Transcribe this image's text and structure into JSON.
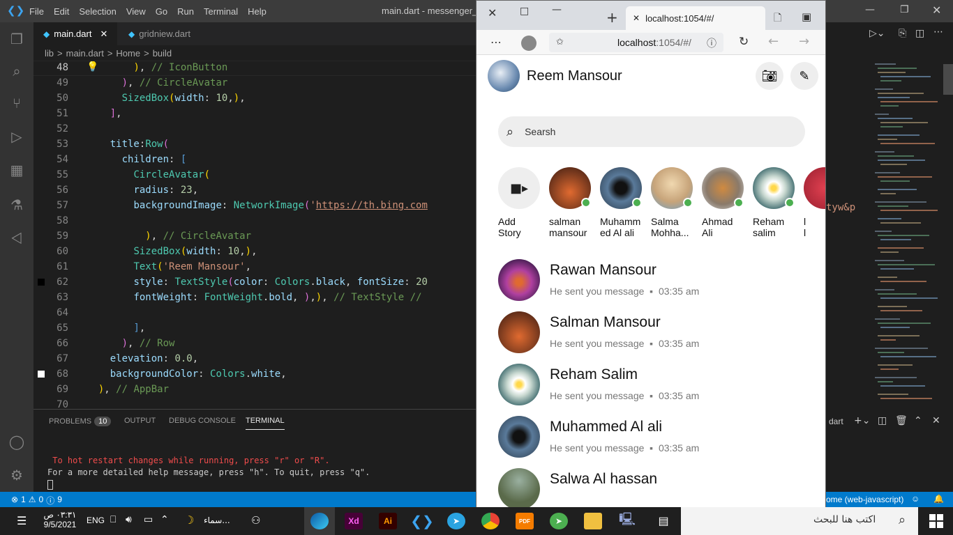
{
  "window": {
    "menu": [
      "File",
      "Edit",
      "Selection",
      "View",
      "Go",
      "Run",
      "Terminal",
      "Help"
    ],
    "title": "main.dart - messenger_pr"
  },
  "editor": {
    "tabs": [
      {
        "label": "main.dart",
        "active": true
      },
      {
        "label": "gridniew.dart",
        "active": false
      }
    ],
    "breadcrumb": [
      "lib",
      ">",
      "main.dart",
      ">",
      "Home",
      ">",
      "build"
    ],
    "line_numbers": [
      "48",
      "49",
      "50",
      "51",
      "52",
      "53",
      "54",
      "55",
      "56",
      "57",
      "58",
      "59",
      "60",
      "61",
      "62",
      "63",
      "64",
      "65",
      "66",
      "67",
      "68",
      "69",
      "70"
    ],
    "current_line": "48"
  },
  "panel": {
    "tabs": [
      "PROBLEMS",
      "OUTPUT",
      "DEBUG CONSOLE",
      "TERMINAL"
    ],
    "problems_count": "10",
    "active_tab": "TERMINAL",
    "right_label": "dart",
    "terminal_lines": [
      " To hot restart changes while running, press \"r\" or \"R\".",
      "For a more detailed help message, press \"h\". To quit, press \"q\"."
    ],
    "prompt": ""
  },
  "statusbar": {
    "errors": "1",
    "warnings": "0",
    "info": "9",
    "right_text": "ome (web-javascript)"
  },
  "browser": {
    "tab_title": "localhost:1054/#/",
    "url_host": "localhost",
    "url_path": ":1054/#/"
  },
  "app": {
    "profile_name": "Reem Mansour",
    "search_placeholder": "Searsh",
    "stories": [
      {
        "name_line1": "Add",
        "name_line2": "Story",
        "type": "add",
        "online": false
      },
      {
        "name_line1": "salman",
        "name_line2": "mansour",
        "online": true,
        "color": "#7a3a1e"
      },
      {
        "name_line1": "Muhamm",
        "name_line2": "ed Al ali",
        "online": true,
        "color": "#2a3a4a"
      },
      {
        "name_line1": "Salma",
        "name_line2": "Mohha...",
        "online": true,
        "color": "#c7a47a"
      },
      {
        "name_line1": "Ahmad",
        "name_line2": "Ali",
        "online": true,
        "color": "#8a7a6a"
      },
      {
        "name_line1": "Reham",
        "name_line2": "salim",
        "online": true,
        "color": "#3f6b6e"
      },
      {
        "name_line1": "l",
        "name_line2": "l",
        "online": false,
        "color": "#9a2030"
      }
    ],
    "chats": [
      {
        "name": "Rawan Mansour",
        "message": "He sent you message",
        "time": "03:35 am",
        "color": "#5a2a6a"
      },
      {
        "name": "Salman Mansour",
        "message": "He sent you message",
        "time": "03:35 am",
        "color": "#7a3a1e"
      },
      {
        "name": "Reham Salim",
        "message": "He sent you message",
        "time": "03:35 am",
        "color": "#3f6b6e"
      },
      {
        "name": "Muhammed Al ali",
        "message": "He sent you message",
        "time": "03:35 am",
        "color": "#2a3a4a"
      },
      {
        "name": "Salwa Al hassan",
        "message": "",
        "time": "",
        "color": "#5a6a4a"
      }
    ]
  },
  "taskbar": {
    "time": "٠٣:٣١ ص",
    "date": "9/5/2021",
    "lang": "ENG",
    "weather": "سماء...",
    "search_placeholder": "اكتب هنا للبحث",
    "apps": [
      "Xd",
      "Ai",
      "PDF"
    ]
  },
  "colors": {
    "accent": "#007acc",
    "online": "#4caf50"
  }
}
